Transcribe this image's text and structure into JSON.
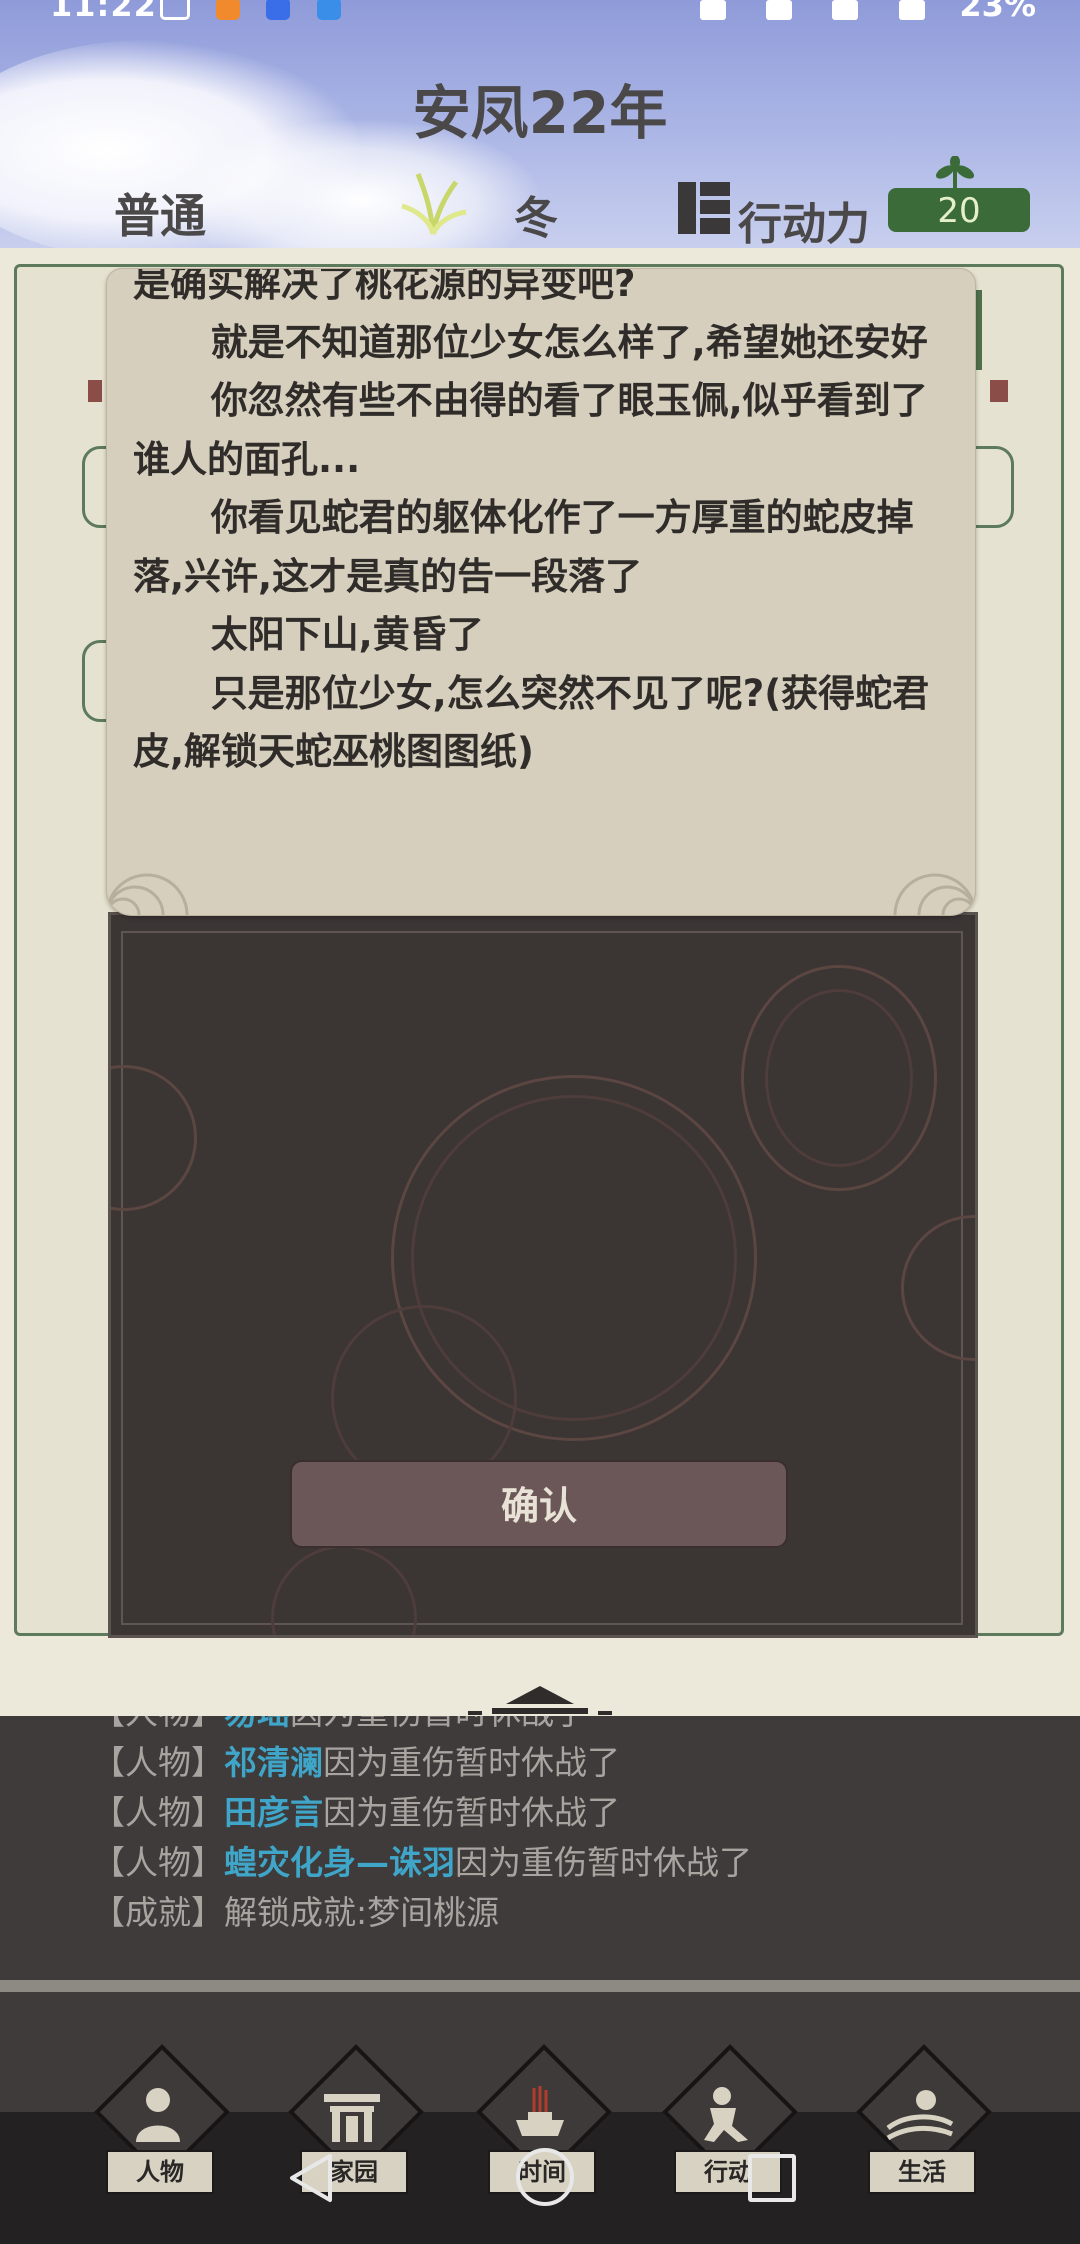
{
  "status_bar": {
    "time": "11:22",
    "battery": "23%"
  },
  "header": {
    "year_title": "安凤22年",
    "difficulty": "普通",
    "season": "冬",
    "action_points_label": "行动力",
    "action_points_value": "20"
  },
  "dialog": {
    "story_lines": [
      "是确实解决了桃花源的异变吧?",
      "就是不知道那位少女怎么样了,希望她还安好",
      "你忽然有些不由得的看了眼玉佩,似乎看到了谁人的面孔...",
      "你看见蛇君的躯体化作了一方厚重的蛇皮掉落,兴许,这才是真的告一段落了",
      "太阳下山,黄昏了",
      "只是那位少女,怎么突然不见了呢?(获得蛇君皮,解锁天蛇巫桃图图纸)"
    ],
    "confirm_label": "确认"
  },
  "log": {
    "rows": [
      {
        "tag": "【人物】",
        "name": "易瑶",
        "text": "因为重伤暂时休战了"
      },
      {
        "tag": "【人物】",
        "name": "祁清澜",
        "text": "因为重伤暂时休战了"
      },
      {
        "tag": "【人物】",
        "name": "田彦言",
        "text": "因为重伤暂时休战了"
      },
      {
        "tag": "【人物】",
        "name": "蝗灾化身—诛羽",
        "text": "因为重伤暂时休战了"
      },
      {
        "tag": "【成就】",
        "name": "",
        "text": "解锁成就:梦间桃源"
      }
    ]
  },
  "nav": {
    "items": [
      {
        "label": "人物",
        "icon": "person-icon"
      },
      {
        "label": "家园",
        "icon": "gate-icon"
      },
      {
        "label": "时间",
        "icon": "incense-icon"
      },
      {
        "label": "行动",
        "icon": "action-icon"
      },
      {
        "label": "生活",
        "icon": "sun-field-icon"
      }
    ]
  },
  "colors": {
    "header_sky": "#a7b2e4",
    "ap_box": "#3c6b3a",
    "log_name": "#3fa6c9",
    "dialog_paper": "#d6cfbe",
    "dialog_dark": "#3b3534",
    "confirm_button": "#6b5757"
  }
}
